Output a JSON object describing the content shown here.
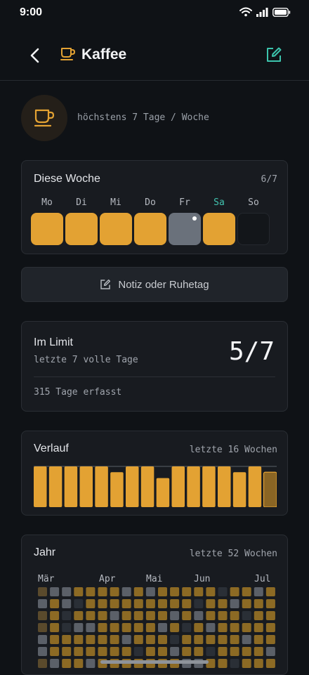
{
  "status": {
    "time": "9:00"
  },
  "header": {
    "title": "Kaffee"
  },
  "goal": {
    "text": "höchstens 7 Tage / Woche"
  },
  "week": {
    "title": "Diese Woche",
    "count": "6/7",
    "days": [
      {
        "label": "Mo",
        "state": "filled",
        "today": false
      },
      {
        "label": "Di",
        "state": "filled",
        "today": false
      },
      {
        "label": "Mi",
        "state": "filled",
        "today": false
      },
      {
        "label": "Do",
        "state": "filled",
        "today": false
      },
      {
        "label": "Fr",
        "state": "rest",
        "today": false,
        "note": true
      },
      {
        "label": "Sa",
        "state": "filled",
        "today": true
      },
      {
        "label": "So",
        "state": "empty",
        "today": false
      }
    ]
  },
  "note_button": {
    "label": "Notiz oder Ruhetag"
  },
  "limit": {
    "title": "Im Limit",
    "subtitle": "letzte 7 volle Tage",
    "value": "5/7",
    "tracked": "315 Tage erfasst"
  },
  "verlauf": {
    "title": "Verlauf",
    "range": "letzte 16 Wochen"
  },
  "jahr": {
    "title": "Jahr",
    "range": "letzte 52 Wochen",
    "months": [
      "Mär",
      "Apr",
      "Mai",
      "Jun",
      "Jul"
    ]
  },
  "chart_data": {
    "type": "bar",
    "title": "Verlauf",
    "categories": [
      "1",
      "2",
      "3",
      "4",
      "5",
      "6",
      "7",
      "8",
      "9",
      "10",
      "11",
      "12",
      "13",
      "14",
      "15",
      "16"
    ],
    "values": [
      7,
      7,
      7,
      7,
      7,
      6,
      7,
      7,
      5,
      7,
      7,
      7,
      7,
      6,
      7,
      6
    ],
    "ylim": [
      0,
      7
    ],
    "current_week_index": 15
  },
  "colors": {
    "accent": "#e3a233",
    "rest": "#6a717b",
    "today": "#42c4b0",
    "background": "#0f1216",
    "card": "#181b20"
  },
  "icons": {
    "back": "chevron-left-icon",
    "cup": "coffee-cup-icon",
    "edit": "edit-icon",
    "wifi": "wifi-icon",
    "signal": "signal-icon",
    "battery": "battery-icon"
  }
}
